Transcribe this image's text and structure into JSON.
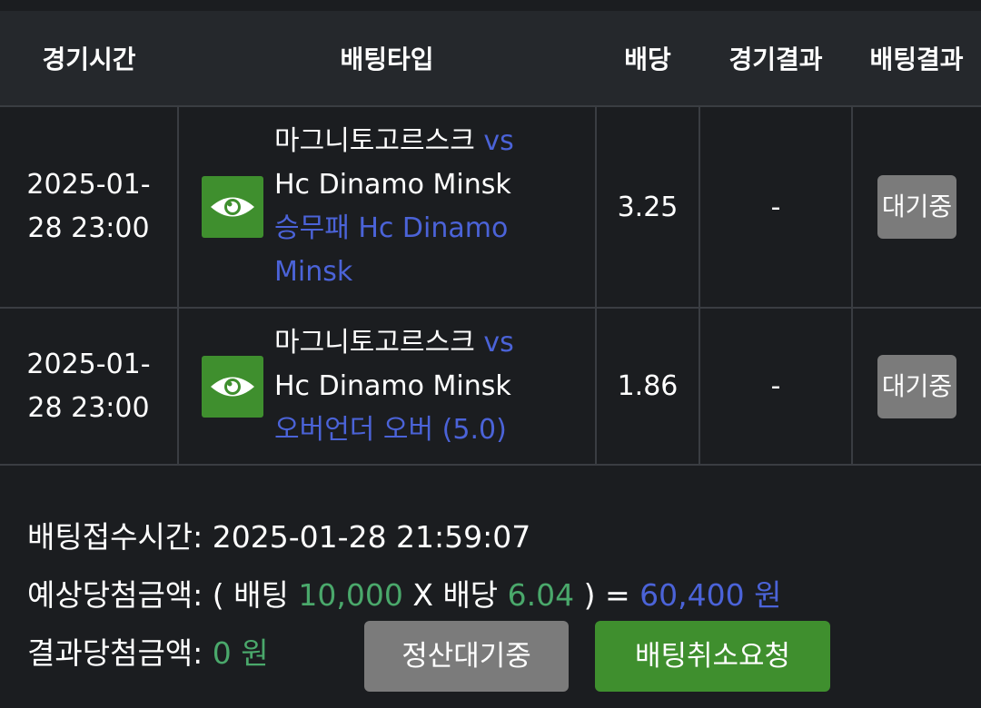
{
  "table": {
    "headers": [
      "경기시간",
      "배팅타입",
      "배당",
      "경기결과",
      "배팅결과"
    ],
    "rows": [
      {
        "time": "2025-01-28 23:00",
        "team_home": "마그니토고르스크",
        "vs": "vs",
        "team_away": "Hc Dinamo Minsk",
        "bet_type": "승무패 Hc Dinamo Minsk",
        "odds": "3.25",
        "game_result": "-",
        "bet_result": "대기중"
      },
      {
        "time": "2025-01-28 23:00",
        "team_home": "마그니토고르스크",
        "vs": "vs",
        "team_away": "Hc Dinamo Minsk",
        "bet_type": "오버언더 오버 (5.0)",
        "odds": "1.86",
        "game_result": "-",
        "bet_result": "대기중"
      }
    ]
  },
  "summary": {
    "received_label": "배팅접수시간:",
    "received_value": "2025-01-28 21:59:07",
    "expected_label": "예상당첨금액:",
    "expected_open": "( 배팅",
    "bet_amount": "10,000",
    "times": "X 배당",
    "total_odds": "6.04",
    "expected_close": ") =",
    "expected_amount": "60,400 원",
    "result_label": "결과당첨금액:",
    "result_amount": "0 원"
  },
  "buttons": {
    "settle_label": "정산대기중",
    "cancel_label": "배팅취소요청"
  },
  "icons": {
    "detail": "eye-icon"
  },
  "colors": {
    "background": "#1b1d20",
    "header_bg": "#25282c",
    "accent_blue": "#4b63d8",
    "accent_green_text": "#4aa86b",
    "button_green": "#3f8f2e",
    "button_gray": "#7b7b7b"
  }
}
